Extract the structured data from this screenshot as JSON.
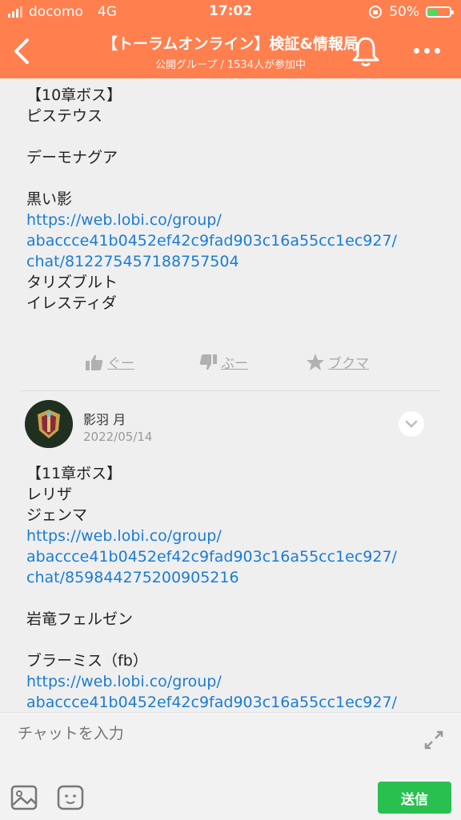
{
  "status": {
    "carrier": "docomo",
    "network": "4G",
    "time": "17:02",
    "battery": "50%",
    "battery_level": 0.5
  },
  "header": {
    "title": "【トーラムオンライン】検証&情報局",
    "subtitle": "公開グループ / 1534人が参加中",
    "colors": {
      "bar": "#ff7f4f"
    }
  },
  "post1": {
    "lines": [
      {
        "text": "【10章ボス】",
        "link": false
      },
      {
        "text": "ピステウス",
        "link": false
      },
      {
        "text": "",
        "link": false
      },
      {
        "text": "デーモナグア",
        "link": false
      },
      {
        "text": "",
        "link": false
      },
      {
        "text": "黒い影",
        "link": false
      },
      {
        "text": "https://web.lobi.co/group/",
        "link": true
      },
      {
        "text": "abaccce41b0452ef42c9fad903c16a55cc1ec927/",
        "link": true
      },
      {
        "text": "chat/812275457188757504",
        "link": true
      },
      {
        "text": "タリズブルト",
        "link": false
      },
      {
        "text": "イレスティダ",
        "link": false
      }
    ],
    "actions": {
      "good": "ぐー",
      "boo": "ぶー",
      "bookmark": "ブクマ"
    }
  },
  "post2": {
    "author": "影羽 月",
    "date": "2022/05/14",
    "lines": [
      {
        "text": "【11章ボス】",
        "link": false
      },
      {
        "text": "レリザ",
        "link": false
      },
      {
        "text": "ジェンマ",
        "link": false
      },
      {
        "text": "https://web.lobi.co/group/",
        "link": true
      },
      {
        "text": "abaccce41b0452ef42c9fad903c16a55cc1ec927/",
        "link": true
      },
      {
        "text": "chat/859844275200905216",
        "link": true
      },
      {
        "text": "",
        "link": false
      },
      {
        "text": "岩竜フェルゼン",
        "link": false
      },
      {
        "text": "",
        "link": false
      },
      {
        "text": "ブラーミス（fb）",
        "link": false
      },
      {
        "text": "https://web.lobi.co/group/",
        "link": true
      },
      {
        "text": "abaccce41b0452ef42c9fad903c16a55cc1ec927/",
        "link": true
      }
    ]
  },
  "composer": {
    "placeholder": "チャットを入力",
    "send_label": "送信",
    "colors": {
      "send": "#2ac04f",
      "link": "#1a7cd6"
    }
  },
  "icons": [
    "back-chevron-icon",
    "bell-icon",
    "more-icon",
    "thumbs-up-icon",
    "thumbs-down-icon",
    "star-icon",
    "chevron-down-icon",
    "expand-icon",
    "image-icon",
    "stamp-icon"
  ]
}
